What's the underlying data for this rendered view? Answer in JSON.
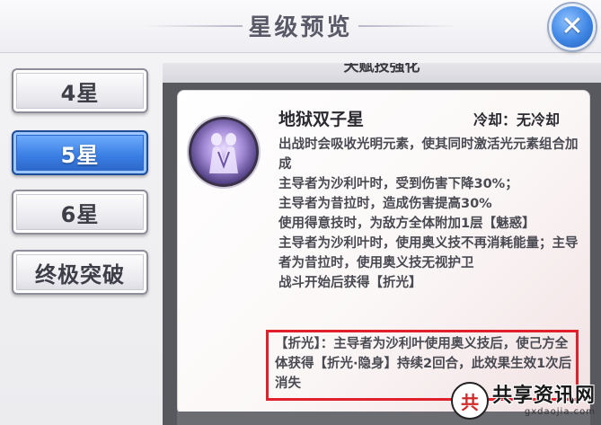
{
  "window": {
    "title": "星级预览",
    "close_icon": "close-icon"
  },
  "tabs": [
    {
      "label": "4星",
      "active": false
    },
    {
      "label": "5星",
      "active": true
    },
    {
      "label": "6星",
      "active": false
    },
    {
      "label": "终极突破",
      "active": false
    }
  ],
  "section": {
    "header": "天赋技强化"
  },
  "skill": {
    "name": "地狱双子星",
    "cooldown": "冷却：无冷却",
    "description": [
      "出战时会吸收光明元素，使其同时激活光元素组合加成",
      "主导者为沙利叶时，受到伤害下降30%；",
      "主导者为昔拉时，造成伤害提高30%",
      "使用得意技时，为敌方全体附加1层【魅惑】",
      "主导者为沙利叶时，使用奥义技不再消耗能量；主导者为昔拉时，使用奥义技无视护卫",
      "战斗开始后获得【折光】"
    ],
    "note": "【折光】：主导者为沙利叶使用奥义技后，使己方全体获得【折光·隐身】持续2回合，此效果生效1次后消失"
  },
  "watermark": {
    "logo_char": "共",
    "text": "共享资讯网",
    "subtext": "gxdaojia.com"
  }
}
